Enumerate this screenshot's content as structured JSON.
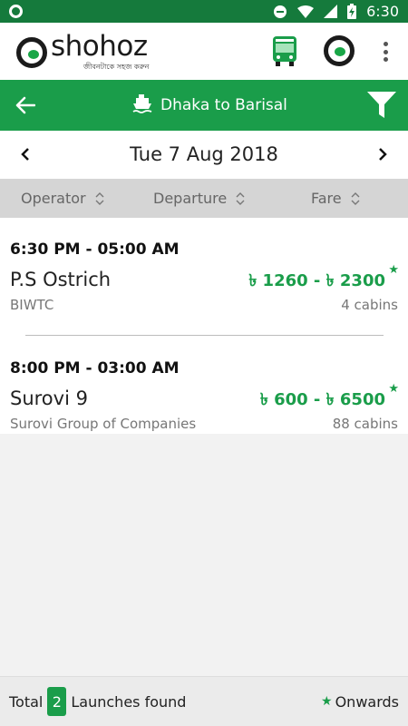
{
  "status_bar": {
    "time": "6:30",
    "icons": [
      "notification-icon",
      "minus-circle-icon",
      "wifi-icon",
      "signal-icon",
      "battery-charging-icon"
    ]
  },
  "header": {
    "logo_text": "shohoz",
    "logo_tagline": "জীবনটাকে সহজ করুন",
    "icons": [
      "bus-icon",
      "shohoz-logo-icon",
      "more-vertical-icon"
    ]
  },
  "toolbar": {
    "title": "Dhaka to Barisal",
    "icons": [
      "back-arrow-icon",
      "ship-icon",
      "filter-icon"
    ]
  },
  "date_bar": {
    "date": "Tue 7 Aug 2018"
  },
  "sort_bar": {
    "items": [
      "Operator",
      "Departure",
      "Fare"
    ]
  },
  "results": [
    {
      "time": "6:30 PM - 05:00 AM",
      "name": "P.S Ostrich",
      "operator": "BIWTC",
      "fare": "৳ 1260 - ৳ 2300",
      "cabins": "4 cabins"
    },
    {
      "time": "8:00 PM - 03:00 AM",
      "name": "Surovi 9",
      "operator": "Surovi Group of Companies",
      "fare": "৳ 600 - ৳ 6500",
      "cabins": "88 cabins"
    }
  ],
  "footer": {
    "total_label": "Total",
    "count": "2",
    "found_label": "Launches found",
    "onwards_label": "Onwards"
  },
  "colors": {
    "primary_green": "#1a9d4a",
    "status_green": "#157a3c"
  }
}
